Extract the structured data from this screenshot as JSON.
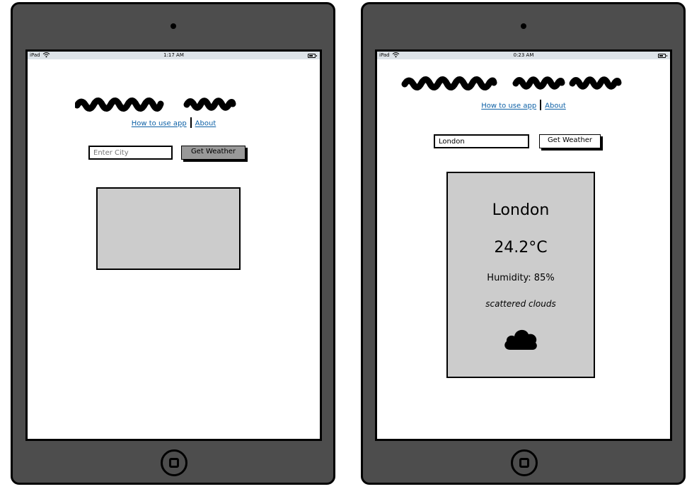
{
  "devices": [
    {
      "status_bar": {
        "carrier": "iPad",
        "time": "1:17 AM"
      },
      "nav": {
        "how_to": "How to use app",
        "about": "About"
      },
      "search": {
        "placeholder": "Enter City",
        "value": "",
        "button_label": "Get Weather"
      }
    },
    {
      "status_bar": {
        "carrier": "iPad",
        "time": "0:23 AM"
      },
      "nav": {
        "how_to": "How to use app",
        "about": "About"
      },
      "search": {
        "placeholder": "Enter City",
        "value": "London",
        "button_label": "Get Weather"
      },
      "result": {
        "city": "London",
        "temperature": "24.2°C",
        "humidity": "Humidity: 85%",
        "description": "scattered clouds",
        "icon": "cloud-icon"
      }
    }
  ],
  "colors": {
    "device_body": "#4d4d4d",
    "status_bar": "#dde3e8",
    "link": "#0b5fa5",
    "result_box": "#cccccc",
    "button_primary": "#999999",
    "button_secondary": "#ffffff"
  }
}
